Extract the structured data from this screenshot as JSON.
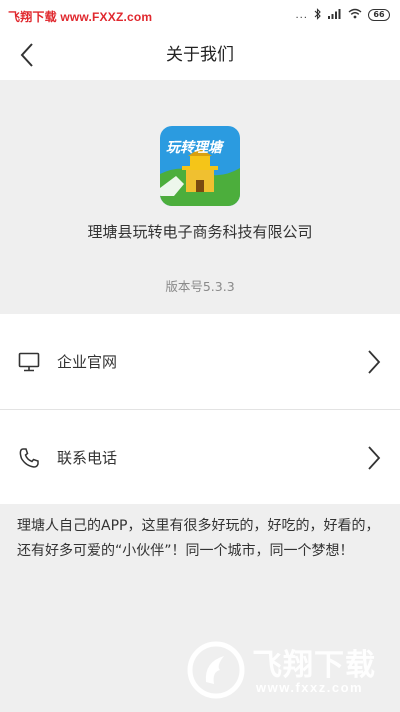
{
  "status_bar": {
    "watermark": "飞翔下载 www.FXXZ.com",
    "dots": "...",
    "battery": "66"
  },
  "nav": {
    "title": "关于我们"
  },
  "about": {
    "logo_text": "玩转理塘",
    "company_name": "理塘县玩转电子商务科技有限公司",
    "version": "版本号5.3.3"
  },
  "menu": {
    "items": [
      {
        "label": "企业官网",
        "icon": "monitor-icon"
      },
      {
        "label": "联系电话",
        "icon": "phone-icon"
      }
    ]
  },
  "description": "理塘人自己的APP，这里有很多好玩的，好吃的，好看的，还有好多可爱的“小伙伴”！同一个城市，同一个梦想！",
  "watermark_bottom": {
    "title": "飞翔下载",
    "url": "www.fxxz.com"
  },
  "colors": {
    "watermark_red": "#e0282e",
    "background": "#efefef",
    "card": "#ffffff"
  }
}
